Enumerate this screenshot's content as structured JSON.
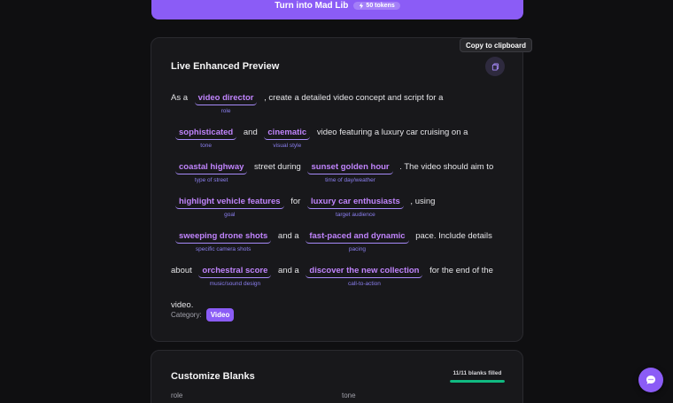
{
  "top_button": {
    "label": "Turn into Mad Lib",
    "tokens": "50 tokens"
  },
  "tooltip": "Copy to clipboard",
  "preview": {
    "title": "Live Enhanced Preview",
    "segments": [
      {
        "text": "As a"
      },
      {
        "value": "video director",
        "hint": "role"
      },
      {
        "text": ", create a detailed video concept and script for a"
      },
      {
        "value": "sophisticated",
        "hint": "tone"
      },
      {
        "text": "and"
      },
      {
        "value": "cinematic",
        "hint": "visual style"
      },
      {
        "text": "video featuring a luxury car cruising on a"
      },
      {
        "value": "coastal highway",
        "hint": "type of street"
      },
      {
        "text": "street during"
      },
      {
        "value": "sunset golden hour",
        "hint": "time of day/weather"
      },
      {
        "text": ". The video should aim to"
      },
      {
        "value": "highlight vehicle features",
        "hint": "goal"
      },
      {
        "text": "for"
      },
      {
        "value": "luxury car enthusiasts",
        "hint": "target audience"
      },
      {
        "text": ", using"
      },
      {
        "value": "sweeping drone shots",
        "hint": "specific camera shots"
      },
      {
        "text": "and a"
      },
      {
        "value": "fast-paced and dynamic",
        "hint": "pacing"
      },
      {
        "text": "pace. Include details about"
      },
      {
        "value": "orchestral score",
        "hint": "music/sound design"
      },
      {
        "text": "and a"
      },
      {
        "value": "discover the new collection",
        "hint": "call-to-action"
      },
      {
        "text": "for the end of the video."
      }
    ],
    "category_label": "Category:",
    "category": "Video"
  },
  "blanks": {
    "title": "Customize Blanks",
    "filled_text": "11/11 blanks filled",
    "filled_fraction": 1.0,
    "field_labels": [
      "role",
      "tone"
    ]
  },
  "colors": {
    "accent": "#8b5cf6",
    "blank_text": "#c084fc",
    "progress": "#10b981"
  }
}
